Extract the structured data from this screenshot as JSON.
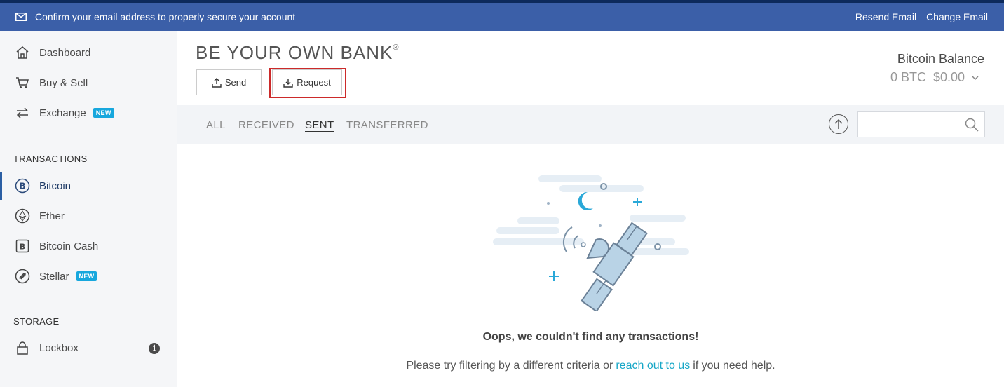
{
  "banner": {
    "message": "Confirm your email address to properly secure your account",
    "resend": "Resend Email",
    "change": "Change Email"
  },
  "sidebar": {
    "items": [
      {
        "label": "Dashboard"
      },
      {
        "label": "Buy & Sell"
      },
      {
        "label": "Exchange",
        "badge": "NEW"
      }
    ],
    "transactions_title": "TRANSACTIONS",
    "transactions": [
      {
        "label": "Bitcoin",
        "active": true
      },
      {
        "label": "Ether"
      },
      {
        "label": "Bitcoin Cash"
      },
      {
        "label": "Stellar",
        "badge": "NEW"
      }
    ],
    "storage_title": "STORAGE",
    "storage": [
      {
        "label": "Lockbox",
        "info_icon": "i"
      }
    ]
  },
  "header": {
    "brand": "BE YOUR OWN BANK",
    "brand_mark": "®",
    "send": "Send",
    "request": "Request",
    "balance_label": "Bitcoin Balance",
    "balance_btc": "0 BTC",
    "balance_fiat": "$0.00"
  },
  "filters": {
    "tabs": [
      {
        "label": "ALL"
      },
      {
        "label": "RECEIVED"
      },
      {
        "label": "SENT",
        "active": true
      },
      {
        "label": "TRANSFERRED"
      }
    ],
    "search_placeholder": ""
  },
  "empty": {
    "title": "Oops, we couldn't find any transactions!",
    "sub_before": "Please try filtering by a different criteria or",
    "sub_link": "reach out to us",
    "sub_after": "if you need help."
  },
  "colors": {
    "banner": "#3b5fa8",
    "accent": "#17a7dd",
    "highlight": "#cc2a2a"
  }
}
